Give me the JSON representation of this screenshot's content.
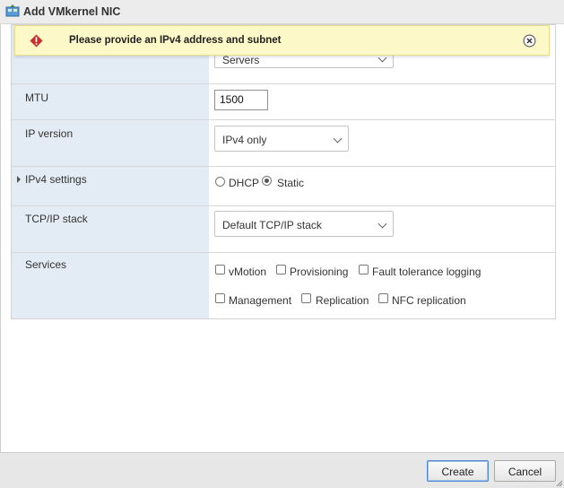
{
  "window": {
    "title": "Add VMkernel NIC"
  },
  "banner": {
    "message": "Please provide an IPv4 address and subnet"
  },
  "form": {
    "portgroup": {
      "value": "Servers"
    },
    "mtu": {
      "label": "MTU",
      "value": "1500"
    },
    "ip_version": {
      "label": "IP version",
      "value": "IPv4 only"
    },
    "ipv4_settings": {
      "label": "IPv4 settings",
      "dhcp_label": "DHCP",
      "static_label": "Static",
      "selected": "Static"
    },
    "tcpip_stack": {
      "label": "TCP/IP stack",
      "value": "Default TCP/IP stack"
    },
    "services": {
      "label": "Services",
      "options": [
        "vMotion",
        "Provisioning",
        "Fault tolerance logging",
        "Management",
        "Replication",
        "NFC replication"
      ]
    }
  },
  "footer": {
    "create_label": "Create",
    "cancel_label": "Cancel"
  },
  "colors": {
    "banner_bg": "#fdf8c8",
    "warning_red": "#c9302c",
    "label_col_bg": "#e3ecf4"
  }
}
